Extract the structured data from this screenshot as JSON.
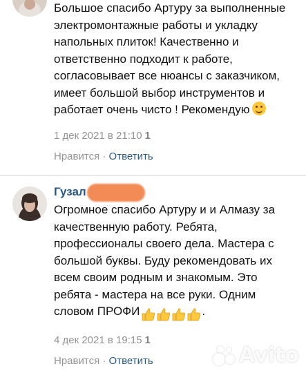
{
  "comments": [
    {
      "text_lines": [
        "Большое спасибо Артуру за выполненные",
        "электромонтажные работы и укладку",
        "напольных плиток! Качественно и",
        "ответственно подходит к работе,",
        "согласовывает все нюансы с заказчиком,",
        "имеет большой выбор инструментов и",
        "работает очень чисто ! Рекомендую"
      ],
      "emoji": "smiling-face-icon",
      "date": "1 дек 2021 в 21:10",
      "count": "1",
      "like_label": "Нравится",
      "separator": " · ",
      "reply_label": "Ответить"
    },
    {
      "author": "Гузал",
      "text_lines": [
        "Огромное спасибо Артуру и и Алмазу за",
        "качественную работу. Ребята,",
        "профессионалы своего дела. Мастера с",
        "большой буквы. Буду рекомендовать их",
        "всем своим родным и знакомым. Это",
        "ребята - мастера на все руки. Одним",
        "словом ПРОФИ"
      ],
      "emoji": "thumbs-up-icon",
      "emoji_count": 4,
      "trailing": ".",
      "date": "4 дек 2021 в 19:15",
      "count": "1",
      "like_label": "Нравится",
      "separator": " · ",
      "reply_label": "Ответить"
    }
  ],
  "watermark": "Avito",
  "colors": {
    "link": "#2a5885",
    "meta": "#939393",
    "separator": "#e7e8ec",
    "redaction": "#f28b56"
  }
}
